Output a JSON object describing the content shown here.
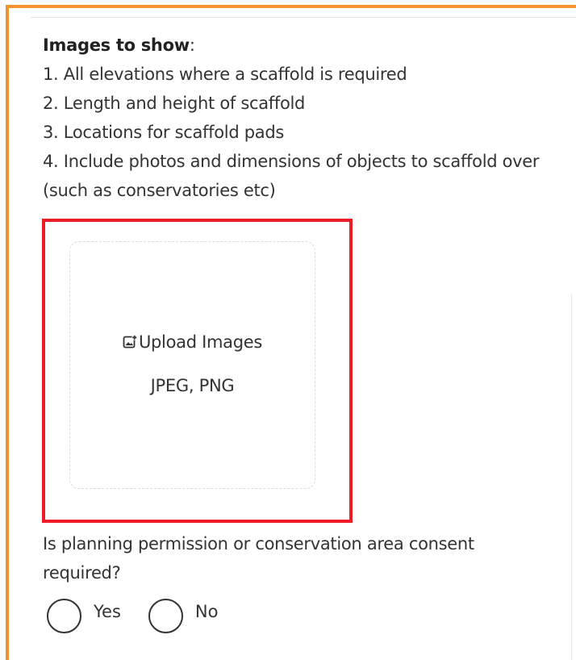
{
  "instructions": {
    "heading": "Images to show",
    "heading_suffix": ":",
    "items": [
      "1. All elevations where a scaffold is required",
      "2. Length and height of scaffold",
      "3. Locations for scaffold pads",
      "4. Include photos and dimensions of objects to scaffold over (such as conservatories etc)"
    ]
  },
  "upload": {
    "icon": "image-upload-icon",
    "label": "Upload Images",
    "formats": "JPEG, PNG",
    "highlight_color": "#ee1c25"
  },
  "planning": {
    "question": "Is planning permission or conservation area consent required?",
    "options": [
      "Yes",
      "No"
    ],
    "selected": null
  },
  "colors": {
    "frame_accent": "#f0922e",
    "highlight": "#ee1c25"
  }
}
